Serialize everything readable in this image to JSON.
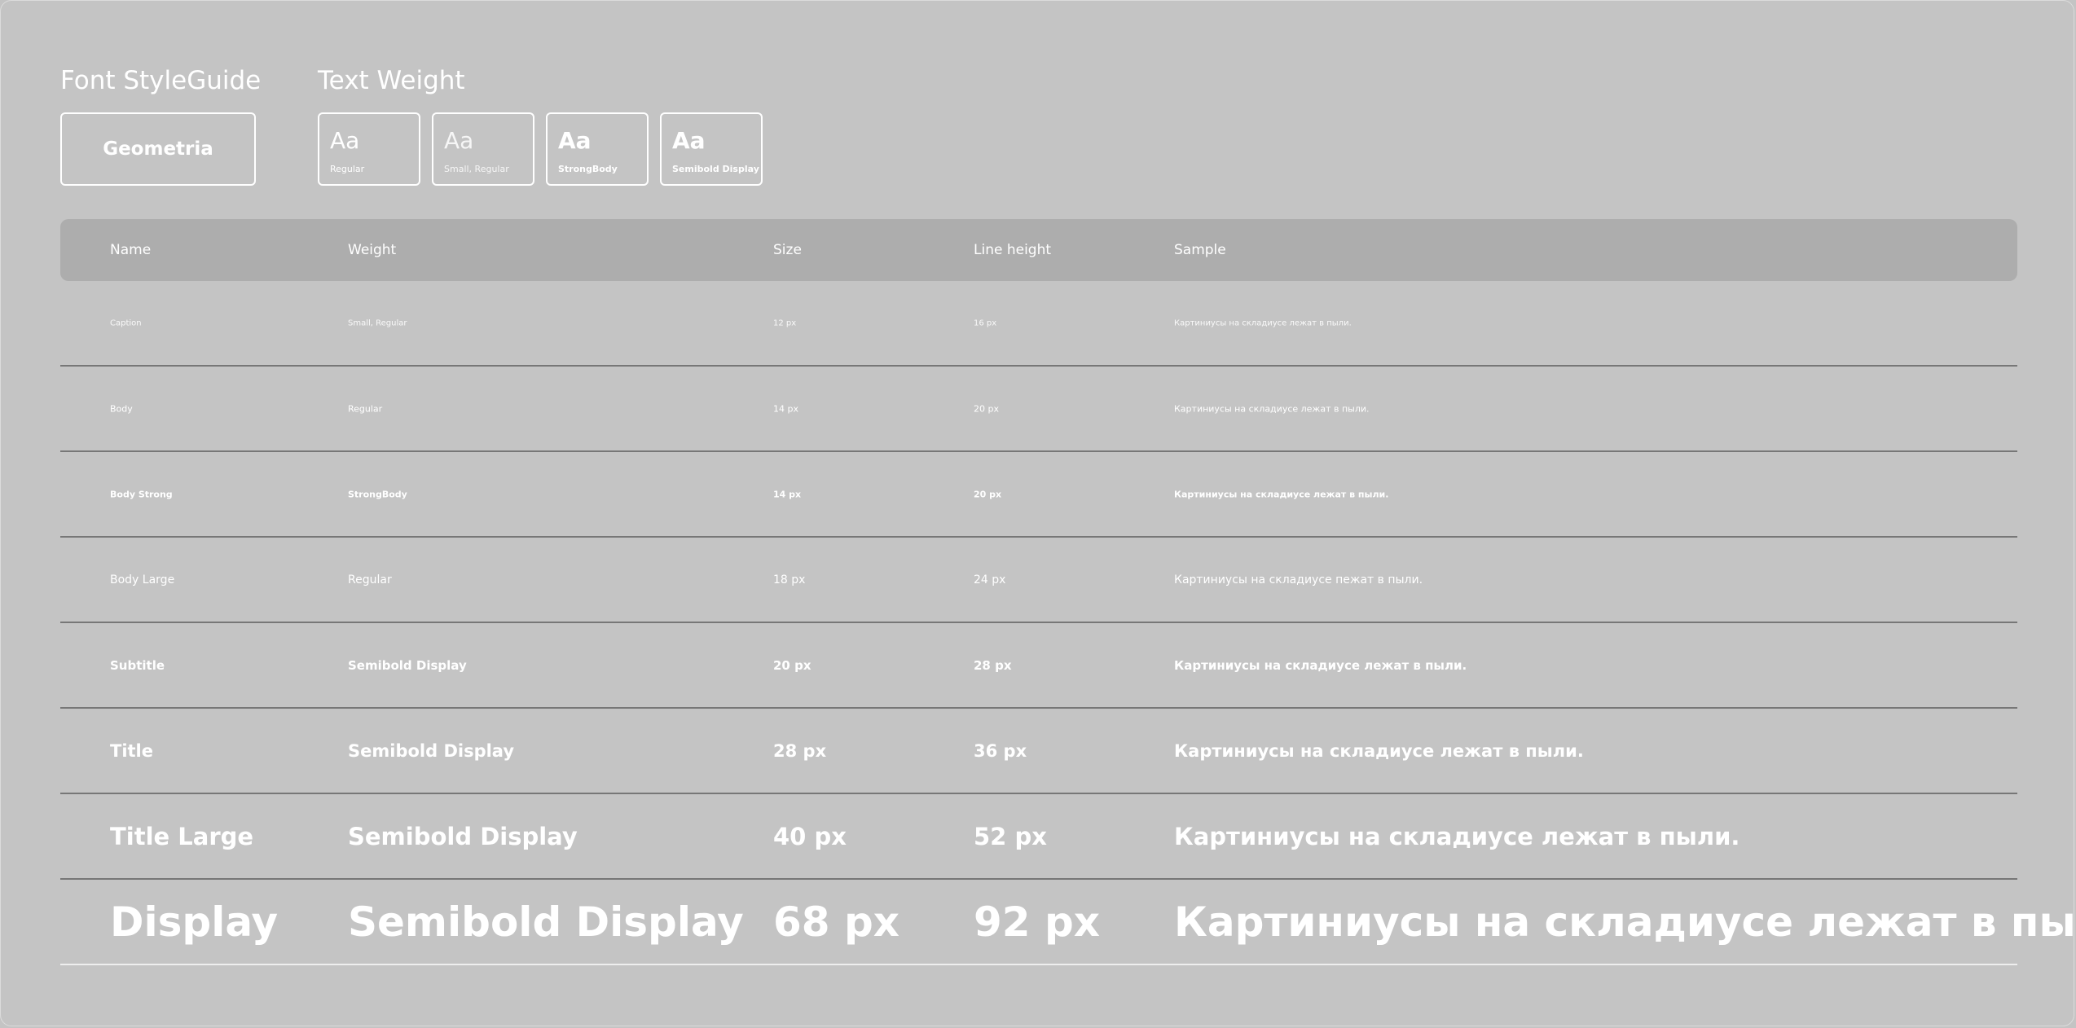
{
  "header": {
    "font_styleguide_title": "Font StyleGuide",
    "text_weight_title": "Text Weight"
  },
  "font_card": {
    "label": "Geometria"
  },
  "weights": [
    {
      "sample": "Aa",
      "label": "Regular"
    },
    {
      "sample": "Aa",
      "label": "Small, Regular"
    },
    {
      "sample": "Aa",
      "label": "StrongBody"
    },
    {
      "sample": "Aa",
      "label": "Semibold Display"
    }
  ],
  "table": {
    "headers": {
      "name": "Name",
      "weight": "Weight",
      "size": "Size",
      "line_height": "Line height",
      "sample": "Sample"
    },
    "rows": [
      {
        "name": "Caption",
        "weight": "Small, Regular",
        "size": "12 px",
        "line_height": "16 px",
        "sample": "Картиниусы на складиусе лежат в пыли."
      },
      {
        "name": "Body",
        "weight": "Regular",
        "size": "14 px",
        "line_height": "20 px",
        "sample": "Картиниусы на складиусе лежат в пыли."
      },
      {
        "name": "Body Strong",
        "weight": "StrongBody",
        "size": "14 px",
        "line_height": "20 px",
        "sample": "Картиниусы на складиусе лежат в пыли."
      },
      {
        "name": "Body Large",
        "weight": "Regular",
        "size": "18 px",
        "line_height": "24 px",
        "sample": "Картиниусы на складиусе пежат в пыли."
      },
      {
        "name": "Subtitle",
        "weight": "Semibold Display",
        "size": "20 px",
        "line_height": "28 px",
        "sample": "Картиниусы на складиусе лежат в пыли."
      },
      {
        "name": "Title",
        "weight": "Semibold Display",
        "size": "28 px",
        "line_height": "36 px",
        "sample": "Картиниусы на складиусе лежат в пыли."
      },
      {
        "name": "Title Large",
        "weight": "Semibold Display",
        "size": "40 px",
        "line_height": "52 px",
        "sample": "Картиниусы на складиусе лежат в пыли."
      },
      {
        "name": "Display",
        "weight": "Semibold Display",
        "size": "68 px",
        "line_height": "92 px",
        "sample": "Картиниусы на складиусе лежат в пыли."
      }
    ]
  },
  "colors": {
    "background": "#c4c4c4",
    "header_row": "#adadad",
    "text": "#ffffff",
    "divider": "#777777"
  }
}
